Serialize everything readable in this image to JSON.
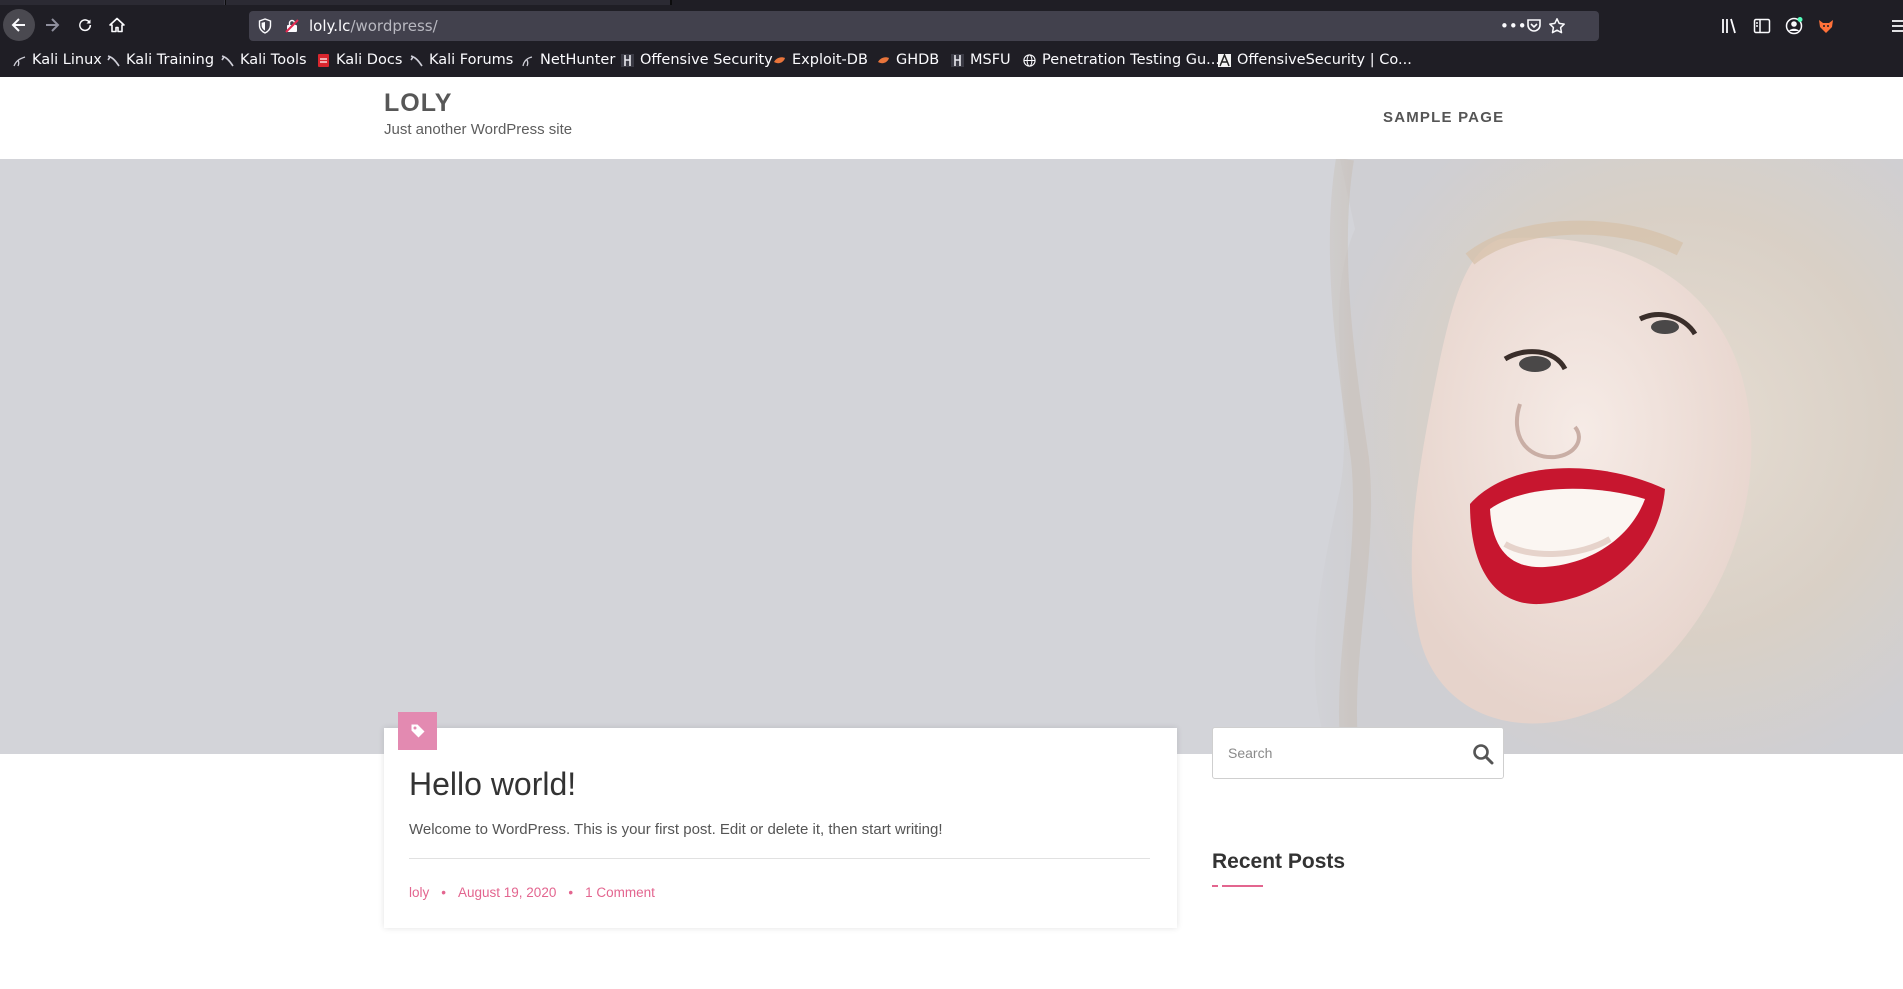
{
  "browser": {
    "url_host": "loly.lc",
    "url_path": "/wordpress/",
    "bookmarks": [
      {
        "label": "Kali Linux",
        "icon": "kali-dragon-icon"
      },
      {
        "label": "Kali Training",
        "icon": "kali-dragon-icon"
      },
      {
        "label": "Kali Tools",
        "icon": "kali-dragon-icon"
      },
      {
        "label": "Kali Docs",
        "icon": "kali-docs-icon"
      },
      {
        "label": "Kali Forums",
        "icon": "kali-dragon-icon"
      },
      {
        "label": "NetHunter",
        "icon": "nethunter-icon"
      },
      {
        "label": "Offensive Security",
        "icon": "offsec-icon"
      },
      {
        "label": "Exploit-DB",
        "icon": "exploitdb-icon"
      },
      {
        "label": "GHDB",
        "icon": "exploitdb-icon"
      },
      {
        "label": "MSFU",
        "icon": "offsec-icon"
      },
      {
        "label": "Penetration Testing Gu...",
        "icon": "globe-icon"
      },
      {
        "label": "OffensiveSecurity | Co...",
        "icon": "offsec-icon"
      }
    ]
  },
  "site": {
    "title": "LOLY",
    "tagline": "Just another WordPress site",
    "menu": {
      "sample_page": "SAMPLE PAGE"
    },
    "accent_color": "#e3658f",
    "tag_color": "#e38ab1"
  },
  "post": {
    "title": "Hello world!",
    "excerpt": "Welcome to WordPress. This is your first post. Edit or delete it, then start writing!",
    "author": "loly",
    "date": "August 19, 2020",
    "comments": "1 Comment",
    "separator": "•"
  },
  "sidebar": {
    "search_placeholder": "Search",
    "recent_posts_title": "Recent Posts"
  }
}
